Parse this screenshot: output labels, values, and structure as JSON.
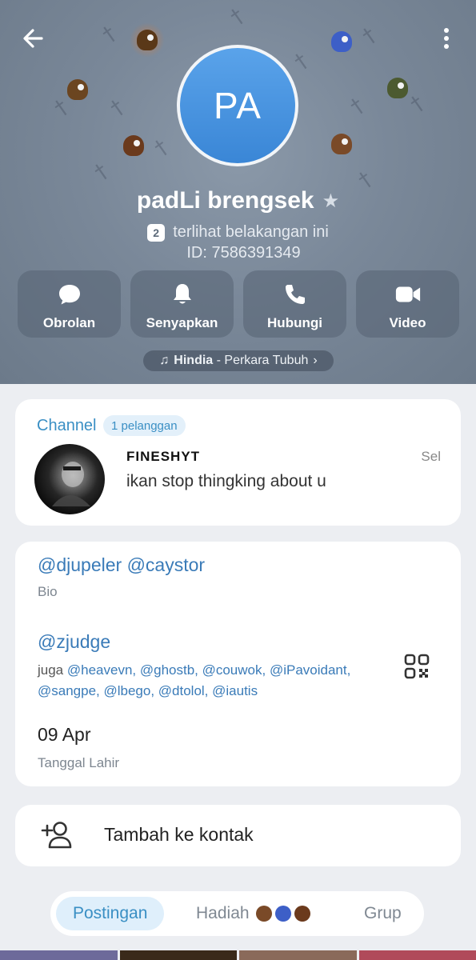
{
  "header": {
    "back_icon": "arrow-left-icon",
    "menu_icon": "more-vertical-icon",
    "avatar_initials": "PA",
    "name": "padLi brengsek",
    "star_icon": "star-icon",
    "status_badge": "2",
    "status_text": "terlihat belakangan ini",
    "id_text": "ID: 7586391349",
    "colors": {
      "background": "#7a8899",
      "avatar": "#4a95e0"
    }
  },
  "actions": [
    {
      "label": "Obrolan",
      "icon": "chat-bubble-icon"
    },
    {
      "label": "Senyapkan",
      "icon": "bell-icon"
    },
    {
      "label": "Hubungi",
      "icon": "phone-icon"
    },
    {
      "label": "Video",
      "icon": "video-camera-icon"
    }
  ],
  "music": {
    "icon": "music-note-icon",
    "artist": "Hindia",
    "title": " - Perkara Tubuh",
    "chevron_icon": "chevron-right-icon"
  },
  "channel": {
    "title": "Channel",
    "subscribers": "1 pelanggan",
    "name": "FINESHYT",
    "message": "ikan stop thingking about u",
    "time": "Sel"
  },
  "info": {
    "bio_value": "@djupeler @caystor",
    "bio_label": "Bio",
    "username_value": "@zjudge",
    "also_prefix": "juga ",
    "also_usernames": "@heavevn, @ghostb, @couwok, @iPavoidant, @sangpe, @lbego, @dtolol, @iautis",
    "qr_icon": "qr-code-icon",
    "birthday_value": "09 Apr",
    "birthday_label": "Tanggal Lahir"
  },
  "contact": {
    "label": "Tambah ke kontak",
    "icon": "add-user-icon"
  },
  "tabs": [
    {
      "label": "Postingan",
      "active": true
    },
    {
      "label": "Hadiah",
      "active": false
    },
    {
      "label": "Grup",
      "active": false
    }
  ],
  "colors": {
    "accent": "#3a8fc4",
    "link": "#3a7bb8",
    "card": "#ffffff",
    "page": "#eceef2"
  }
}
